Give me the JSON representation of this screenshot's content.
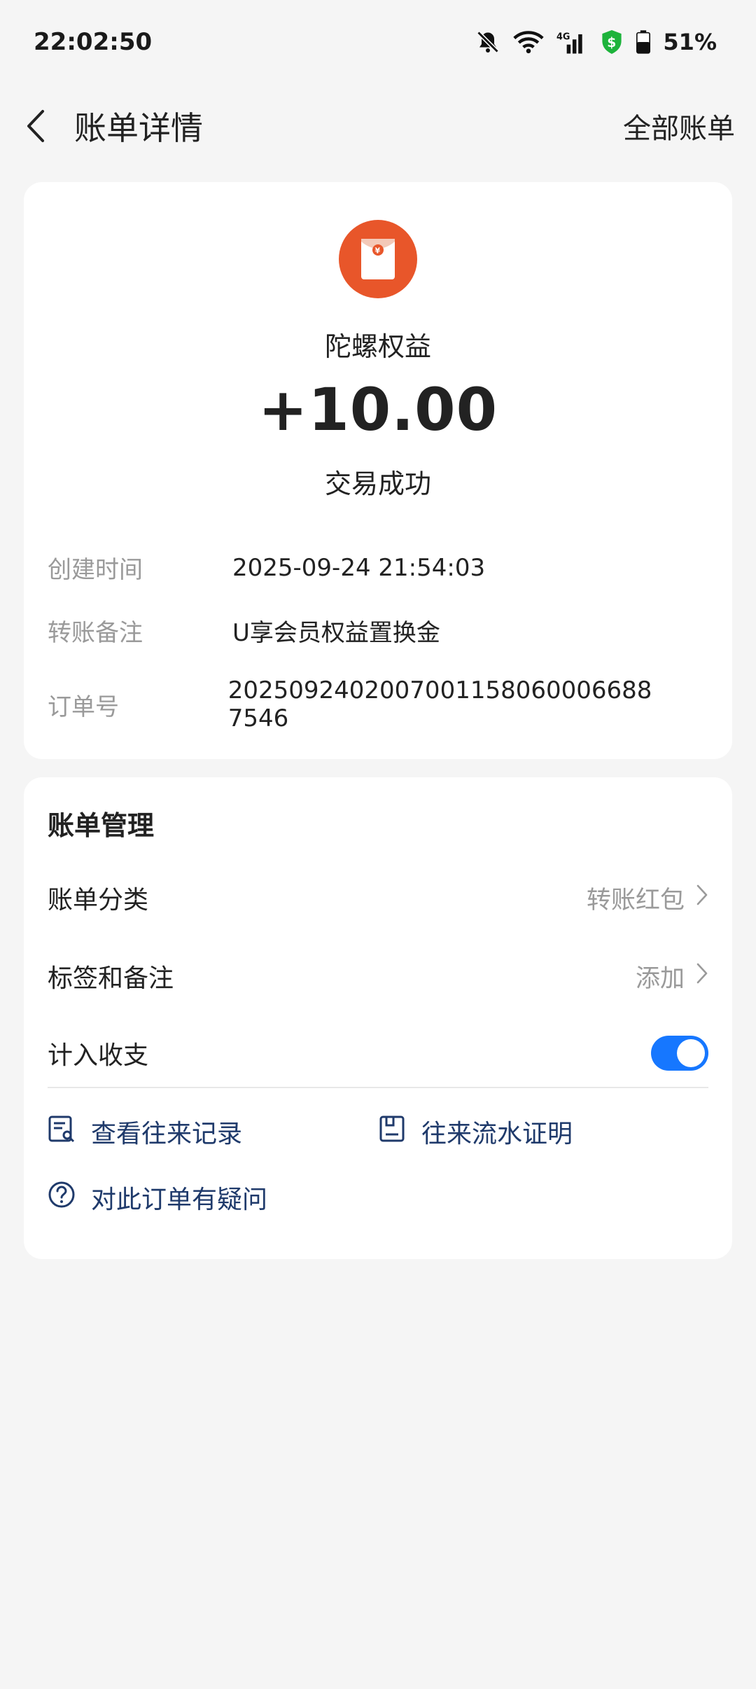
{
  "status_bar": {
    "time": "22:02:50",
    "battery": "51%"
  },
  "header": {
    "title": "账单详情",
    "all_bills": "全部账单"
  },
  "bill": {
    "merchant": "陀螺权益",
    "amount": "+10.00",
    "status": "交易成功",
    "details": [
      {
        "label": "创建时间",
        "value": "2025-09-24 21:54:03"
      },
      {
        "label": "转账备注",
        "value": "U享会员权益置换金"
      },
      {
        "label": "订单号",
        "value": "2025092402007001158060006688 7546"
      }
    ]
  },
  "manage": {
    "title": "账单管理",
    "category_label": "账单分类",
    "category_value": "转账红包",
    "tag_label": "标签和备注",
    "tag_value": "添加",
    "count_label": "计入收支",
    "count_enabled": true,
    "link_records": "查看往来记录",
    "link_proof": "往来流水证明",
    "link_question": "对此订单有疑问"
  },
  "colors": {
    "accent": "#1677ff",
    "logo": "#e8562a",
    "link": "#1f3a6b"
  }
}
